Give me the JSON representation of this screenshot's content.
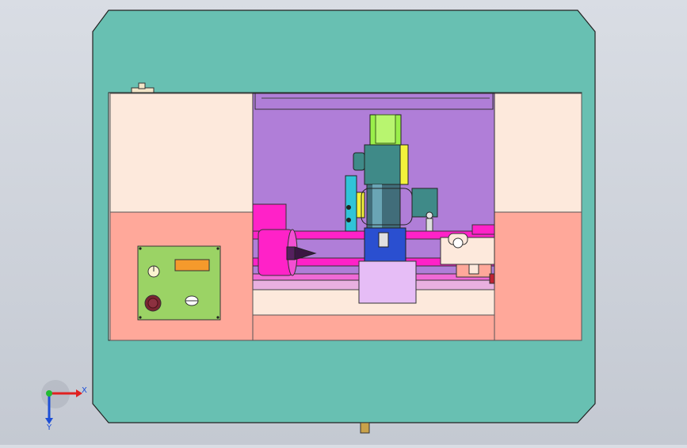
{
  "viewport": {
    "background_top": "#d9dde4",
    "background_bottom": "#c4c9d2"
  },
  "colors": {
    "enclosure": "#68c0b2",
    "upper_panel": "#fde9dc",
    "lower_panel": "#ffa89a",
    "chamber": "#b07ed8",
    "magenta": "#ff22c8",
    "spindle_green": "#9aef4a",
    "head_teal": "#3f8a88",
    "yellow": "#f4f23c",
    "control_panel": "#9bd365",
    "control_display": "#f59a2c"
  },
  "triad": {
    "x_label": "X",
    "y_label": "Y",
    "x_color": "#e02020",
    "y_color": "#1e4fd6",
    "z_color": "#22bb33"
  },
  "icons": [
    "axis-triad-icon",
    "knob-icon",
    "emergency-stop-icon",
    "handle-icon"
  ]
}
